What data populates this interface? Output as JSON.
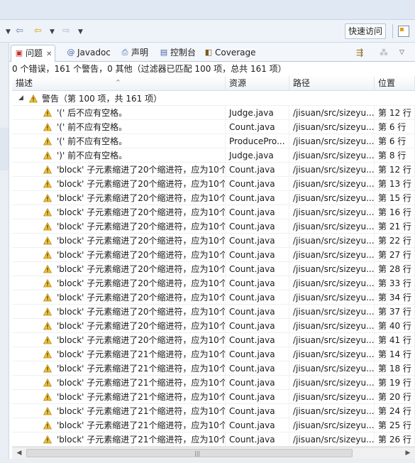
{
  "toolbar": {
    "quick_access": "快速访问"
  },
  "tabs": [
    {
      "label": "问题",
      "icon": "problems-icon"
    },
    {
      "label": "Javadoc",
      "icon": "at-icon"
    },
    {
      "label": "声明",
      "icon": "declaration-icon"
    },
    {
      "label": "控制台",
      "icon": "console-icon"
    },
    {
      "label": "Coverage",
      "icon": "coverage-icon"
    }
  ],
  "summary": "0 个错误，161 个警告，0 其他（过滤器已匹配 100 项，总共 161 项）",
  "columns": [
    "描述",
    "资源",
    "路径",
    "位置"
  ],
  "group": {
    "label": "警告（第 100 项，共 161 项）"
  },
  "rows": [
    [
      "'(' 后不应有空格。",
      "Judge.java",
      "/jisuan/src/sizeyu...",
      "第 12 行"
    ],
    [
      "'(' 前不应有空格。",
      "Count.java",
      "/jisuan/src/sizeyu...",
      "第 6 行"
    ],
    [
      "'(' 前不应有空格。",
      "ProducePro...",
      "/jisuan/src/sizeyu...",
      "第 6 行"
    ],
    [
      "')' 前不应有空格。",
      "Judge.java",
      "/jisuan/src/sizeyu...",
      "第 8 行"
    ],
    [
      "'block' 子元素缩进了20个缩进符，应为10个",
      "Count.java",
      "/jisuan/src/sizeyu...",
      "第 12 行"
    ],
    [
      "'block' 子元素缩进了20个缩进符，应为10个",
      "Count.java",
      "/jisuan/src/sizeyu...",
      "第 13 行"
    ],
    [
      "'block' 子元素缩进了20个缩进符，应为10个",
      "Count.java",
      "/jisuan/src/sizeyu...",
      "第 15 行"
    ],
    [
      "'block' 子元素缩进了20个缩进符，应为10个",
      "Count.java",
      "/jisuan/src/sizeyu...",
      "第 16 行"
    ],
    [
      "'block' 子元素缩进了20个缩进符，应为10个",
      "Count.java",
      "/jisuan/src/sizeyu...",
      "第 21 行"
    ],
    [
      "'block' 子元素缩进了20个缩进符，应为10个",
      "Count.java",
      "/jisuan/src/sizeyu...",
      "第 22 行"
    ],
    [
      "'block' 子元素缩进了20个缩进符，应为10个",
      "Count.java",
      "/jisuan/src/sizeyu...",
      "第 27 行"
    ],
    [
      "'block' 子元素缩进了20个缩进符，应为10个",
      "Count.java",
      "/jisuan/src/sizeyu...",
      "第 28 行"
    ],
    [
      "'block' 子元素缩进了20个缩进符，应为10个",
      "Count.java",
      "/jisuan/src/sizeyu...",
      "第 33 行"
    ],
    [
      "'block' 子元素缩进了20个缩进符，应为10个",
      "Count.java",
      "/jisuan/src/sizeyu...",
      "第 34 行"
    ],
    [
      "'block' 子元素缩进了20个缩进符，应为10个",
      "Count.java",
      "/jisuan/src/sizeyu...",
      "第 37 行"
    ],
    [
      "'block' 子元素缩进了20个缩进符，应为10个",
      "Count.java",
      "/jisuan/src/sizeyu...",
      "第 40 行"
    ],
    [
      "'block' 子元素缩进了20个缩进符，应为10个",
      "Count.java",
      "/jisuan/src/sizeyu...",
      "第 41 行"
    ],
    [
      "'block' 子元素缩进了21个缩进符，应为10个",
      "Count.java",
      "/jisuan/src/sizeyu...",
      "第 14 行"
    ],
    [
      "'block' 子元素缩进了21个缩进符，应为10个",
      "Count.java",
      "/jisuan/src/sizeyu...",
      "第 18 行"
    ],
    [
      "'block' 子元素缩进了21个缩进符，应为10个",
      "Count.java",
      "/jisuan/src/sizeyu...",
      "第 19 行"
    ],
    [
      "'block' 子元素缩进了21个缩进符，应为10个",
      "Count.java",
      "/jisuan/src/sizeyu...",
      "第 20 行"
    ],
    [
      "'block' 子元素缩进了21个缩进符，应为10个",
      "Count.java",
      "/jisuan/src/sizeyu...",
      "第 24 行"
    ],
    [
      "'block' 子元素缩进了21个缩进符，应为10个",
      "Count.java",
      "/jisuan/src/sizeyu...",
      "第 25 行"
    ],
    [
      "'block' 子元素缩进了21个缩进符，应为10个",
      "Count.java",
      "/jisuan/src/sizeyu...",
      "第 26 行"
    ]
  ],
  "colors": {
    "warning": "#f2c230",
    "warning_border": "#b8860b",
    "selection_header": "#eef2f7"
  }
}
